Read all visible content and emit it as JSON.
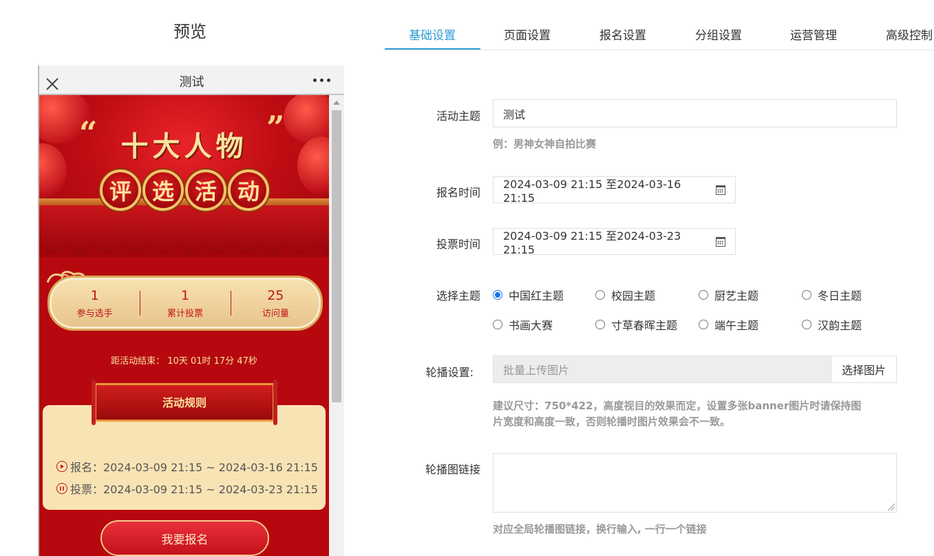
{
  "preview": {
    "heading": "预览",
    "phone_title": "测试",
    "banner": {
      "quote_open": "“",
      "quote_close": "”",
      "title_line1": "十大人物",
      "title_line2": [
        "评",
        "选",
        "活",
        "动"
      ]
    },
    "stats": [
      {
        "value": "1",
        "label": "参与选手"
      },
      {
        "value": "1",
        "label": "累计投票"
      },
      {
        "value": "25",
        "label": "访问量"
      }
    ],
    "countdown": "距活动结束： 10天 01时 17分 47秒",
    "rules_title": "活动规则",
    "rules": [
      {
        "icon": "play-circle-icon",
        "text": "报名：2024-03-09 21:15 ~ 2024-03-16 21:15"
      },
      {
        "icon": "pause-circle-icon",
        "text": "投票：2024-03-09 21:15 ~ 2024-03-23 21:15"
      }
    ],
    "signup_button": "我要报名"
  },
  "tabs": [
    {
      "label": "基础设置",
      "active": true
    },
    {
      "label": "页面设置"
    },
    {
      "label": "报名设置"
    },
    {
      "label": "分组设置"
    },
    {
      "label": "运营管理"
    },
    {
      "label": "高级控制"
    }
  ],
  "form": {
    "topic": {
      "label": "活动主题",
      "value": "测试",
      "hint": "例：男神女神自拍比赛"
    },
    "signup_time": {
      "label": "报名时间",
      "value": "2024-03-09 21:15 至2024-03-16 21:15"
    },
    "vote_time": {
      "label": "投票时间",
      "value": "2024-03-09 21:15 至2024-03-23 21:15"
    },
    "theme": {
      "label": "选择主题",
      "options": [
        "中国红主题",
        "校园主题",
        "厨艺主题",
        "冬日主题",
        "书画大赛",
        "寸草春晖主题",
        "端午主题",
        "汉韵主题"
      ],
      "selected": "中国红主题"
    },
    "carousel": {
      "label": "轮播设置:",
      "placeholder": "批量上传图片",
      "button": "选择图片",
      "hint_line1": "建议尺寸：750*422，高度视目的效果而定，设置多张banner图片时请保持图",
      "hint_line2": "片宽度和高度一致，否则轮播时图片效果会不一致。"
    },
    "carousel_links": {
      "label": "轮播图链接",
      "value": "",
      "hint": "对应全局轮播图链接，换行输入, 一行一个链接"
    }
  },
  "colors": {
    "accent": "#2d9bd6",
    "radio_checked": "#1a73e8",
    "festive_red": "#b7080f"
  }
}
